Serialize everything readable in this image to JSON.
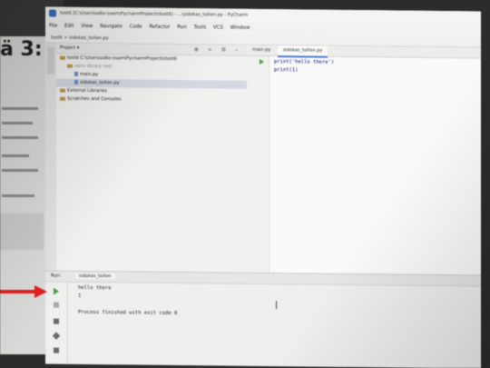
{
  "background_doc": {
    "heading": "ä 3:"
  },
  "window": {
    "title": "tost6 [C:\\Users\\odto-ssam\\PycharmProjects\\tost6] - ...\\sidokas_toiten.py - PyCharm"
  },
  "menu": [
    "File",
    "Edit",
    "View",
    "Navigate",
    "Code",
    "Refactor",
    "Run",
    "Tools",
    "VCS",
    "Window"
  ],
  "navbar": {
    "crumbs": "tost6 > sidokas_toiten.py"
  },
  "project_panel": {
    "label": "Project ▾",
    "root": "tost6  C:\\Users\\odto-ssam\\PycharmProjects\\tost6",
    "venv": "venv  library root",
    "files": [
      "main.py",
      "sidokas_toiten.py"
    ],
    "external": "External Libraries",
    "scratches": "Scratches and Consoles"
  },
  "editor": {
    "tabs": [
      "main.py",
      "sidokas_toiten.py"
    ],
    "active_tab": 1,
    "lines": [
      "print('hello there')",
      "print(1)"
    ]
  },
  "run_panel": {
    "label": "Run:",
    "tab": "sidokas_toiten",
    "output": [
      "hello there",
      "1",
      "",
      "Process finished with exit code 0"
    ]
  },
  "colors": {
    "arrow": "#e02020",
    "run_green": "#49a04b",
    "accent": "#4a7bd0"
  }
}
